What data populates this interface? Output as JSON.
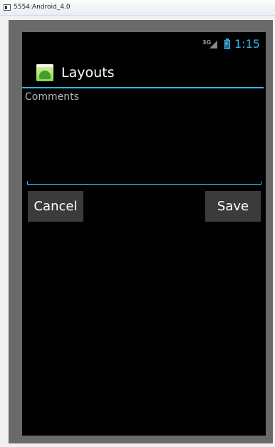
{
  "window": {
    "title": "5554:Android_4.0"
  },
  "status_bar": {
    "network": "3G",
    "time": "1:15"
  },
  "action_bar": {
    "title": "Layouts"
  },
  "form": {
    "comments_placeholder": "Comments",
    "comments_value": ""
  },
  "buttons": {
    "cancel_label": "Cancel",
    "save_label": "Save"
  },
  "colors": {
    "accent": "#33b5e5",
    "screen_bg": "#000000",
    "button_bg": "#3b3b3b"
  }
}
